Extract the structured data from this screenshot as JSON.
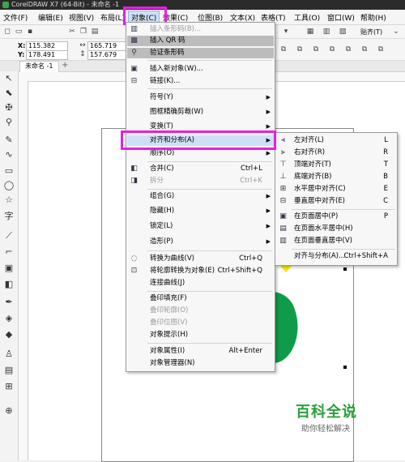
{
  "window": {
    "title": "CorelDRAW X7 (64-Bit) - 未命名 -1"
  },
  "menubar": {
    "items": [
      "文件(F)",
      "编辑(E)",
      "视图(V)",
      "布局(L)",
      "对象(C)",
      "效果(C)",
      "位图(B)",
      "文本(X)",
      "表格(T)",
      "工具(O)",
      "窗口(W)",
      "帮助(H)"
    ]
  },
  "toolbar": {
    "snap_label": "贴齐(T)"
  },
  "propbar": {
    "x_label": "X:",
    "x_value": "115.382 mm",
    "y_label": "Y:",
    "y_value": "178.491 mm",
    "w_value": "165.719 mm",
    "h_value": "157.679 mm"
  },
  "tabs": {
    "doc_tab": "未命名 -1",
    "add_tab": "+"
  },
  "object_menu": {
    "items": [
      {
        "label": "插入条形码(B)...",
        "disabled": true
      },
      {
        "label": "插入 QR 码"
      },
      {
        "label": "验证条形码"
      },
      {
        "label": "插入新对象(W)..."
      },
      {
        "label": "链接(K)..."
      },
      {
        "label": "符号(Y)"
      },
      {
        "label": "图框精确剪裁(W)"
      },
      {
        "label": "变换(T)"
      },
      {
        "label": "对齐和分布(A)"
      },
      {
        "label": "顺序(O)"
      },
      {
        "label": "合并(C)",
        "shortcut": "Ctrl+L"
      },
      {
        "label": "拆分",
        "shortcut": "Ctrl+K",
        "disabled": true
      },
      {
        "label": "组合(G)"
      },
      {
        "label": "隐藏(H)"
      },
      {
        "label": "锁定(L)"
      },
      {
        "label": "造形(P)"
      },
      {
        "label": "转换为曲线(V)",
        "shortcut": "Ctrl+Q"
      },
      {
        "label": "将轮廓转换为对象(E)",
        "shortcut": "Ctrl+Shift+Q"
      },
      {
        "label": "连接曲线(J)"
      },
      {
        "label": "叠印填充(F)"
      },
      {
        "label": "叠印轮廓(O)",
        "disabled": true
      },
      {
        "label": "叠印位图(V)",
        "disabled": true
      },
      {
        "label": "对象提示(H)"
      },
      {
        "label": "对象属性(I)",
        "shortcut": "Alt+Enter"
      },
      {
        "label": "对象管理器(N)"
      }
    ]
  },
  "align_submenu": {
    "items": [
      {
        "label": "左对齐(L)",
        "shortcut": "L"
      },
      {
        "label": "右对齐(R)",
        "shortcut": "R"
      },
      {
        "label": "顶端对齐(T)",
        "shortcut": "T"
      },
      {
        "label": "底端对齐(B)",
        "shortcut": "B"
      },
      {
        "label": "水平居中对齐(C)",
        "shortcut": "E"
      },
      {
        "label": "垂直居中对齐(E)",
        "shortcut": "C"
      },
      {
        "label": "在页面居中(P)",
        "shortcut": "P"
      },
      {
        "label": "在页面水平居中(H)"
      },
      {
        "label": "在页面垂直居中(V)"
      },
      {
        "label": "对齐与分布(A)...",
        "shortcut": "Ctrl+Shift+A"
      }
    ]
  },
  "watermark": {
    "brand": "百科全说",
    "slogan": "助你轻松解决"
  },
  "colors": {
    "highlight": "#e81fe0",
    "accent_green": "#0f9b4a"
  }
}
